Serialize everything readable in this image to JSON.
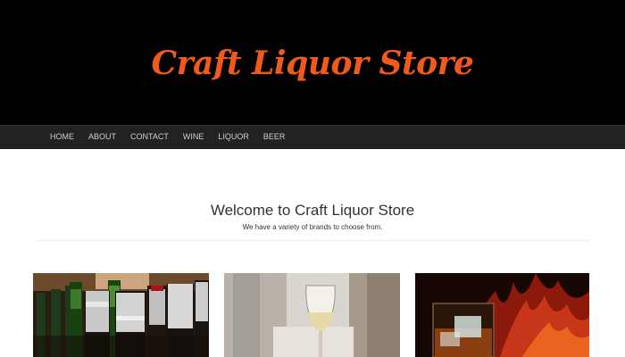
{
  "header": {
    "brand": "Craft Liquor Store"
  },
  "nav": {
    "items": [
      "HOME",
      "ABOUT",
      "CONTACT",
      "WINE",
      "LIQUOR",
      "BEER"
    ]
  },
  "main": {
    "title": "Welcome to Craft Liquor Store",
    "subtitle": "We have a variety of brands to choose from."
  },
  "colors": {
    "brand": "#f25a1b",
    "hero_bg": "#000000",
    "nav_bg": "#222222"
  },
  "images": [
    "beer-bottles-photo",
    "white-wine-glass-photo",
    "whiskey-glass-photo"
  ]
}
